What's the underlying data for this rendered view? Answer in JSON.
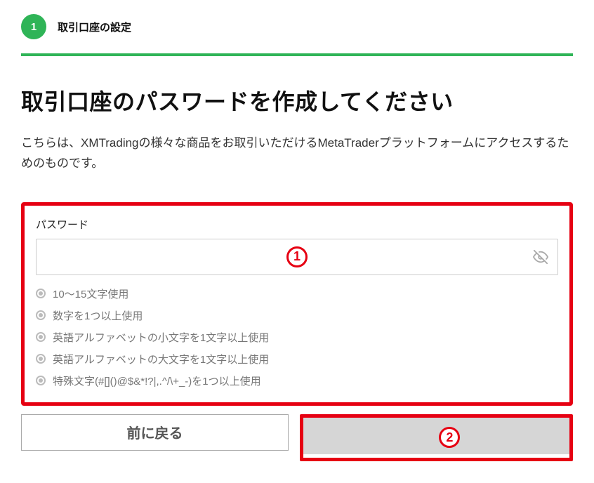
{
  "step": {
    "number": "1",
    "title": "取引口座の設定"
  },
  "page": {
    "title": "取引口座のパスワードを作成してください",
    "subtitle": "こちらは、XMTradingの様々な商品をお取引いただけるMetaTraderプラットフォームにアクセスするためのものです。"
  },
  "password": {
    "label": "パスワード",
    "value": "",
    "rules": [
      "10～15文字使用",
      "数字を1つ以上使用",
      "英語アルファベットの小文字を1文字以上使用",
      "英語アルファベットの大文字を1文字以上使用",
      "特殊文字(#[]()@$&*!?|,.^/\\+_-)を1つ以上使用"
    ]
  },
  "buttons": {
    "back": "前に戻る",
    "submit": ""
  },
  "callouts": {
    "one": "1",
    "two": "2"
  },
  "colors": {
    "accent_green": "#2fb457",
    "accent_red": "#e60012"
  }
}
